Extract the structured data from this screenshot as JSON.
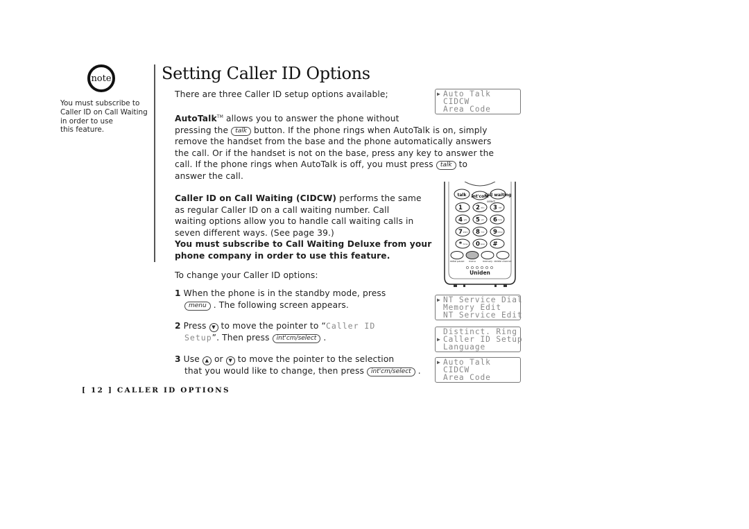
{
  "note": {
    "badge_label": "note",
    "lines": [
      "You must subscribe to",
      "Caller ID on Call Waiting",
      "in order to use",
      "this feature."
    ]
  },
  "title": "Setting Caller ID Options",
  "intro": "There are three Caller ID setup options available;",
  "autotalk": {
    "term": "AutoTalk",
    "tm": "TM",
    "line1_rest": " allows you to answer the phone without",
    "line2_pre": "pressing the ",
    "talk_button": "talk",
    "line2_post": " button. If the phone rings when AutoTalk is on, simply",
    "line3": "remove the handset from the base and the phone automatically answers",
    "line4": "the call. Or if the handset is not on the base, press any key to answer the",
    "line5_pre": "call. If the phone rings when AutoTalk is off, you must press ",
    "line5_post": " to",
    "line6": "answer the call."
  },
  "cidcw": {
    "term": "Caller ID on Call Waiting (CIDCW)",
    "line1_rest": " performs the same",
    "line2": "as regular Caller ID on a call waiting number. Call",
    "line3": "waiting options allow you to handle call waiting calls in",
    "line4": "seven different ways. (See page 39.)",
    "warning_line1": "You must subscribe to Call Waiting Deluxe from your",
    "warning_line2": "phone company in order to use this feature."
  },
  "change_intro": "To change your Caller ID options:",
  "steps": [
    {
      "num": "1",
      "line1": "When the phone is in the standby mode, press",
      "button": "menu",
      "line2_post": ". The following screen appears."
    },
    {
      "num": "2",
      "pre": "Press ",
      "down_icon": "▼",
      "mid": " to move the pointer to “",
      "lcd_text_1": "Caller ID",
      "lcd_text_2": "Setup",
      "post": "”. Then press ",
      "button": "int'cm/select",
      "end": "."
    },
    {
      "num": "3",
      "pre": "Use ",
      "up_icon": "▲",
      "or": " or ",
      "down_icon": "▼",
      "line1_post": " to move the pointer to the selection",
      "line2_pre": "that you would like to change, then press ",
      "button": "int'cm/select",
      "end": "."
    }
  ],
  "lcd_screens": [
    {
      "lines": [
        "Auto Talk",
        "CIDCW",
        "Area Code"
      ],
      "pointer_index": 0
    },
    {
      "lines": [
        "NT Service Dial",
        "Memory Edit",
        "NT Service Edit"
      ],
      "pointer_index": 0
    },
    {
      "lines": [
        "Distinct. Ring",
        "Caller ID Setup",
        "Language"
      ],
      "pointer_index": 1
    },
    {
      "lines": [
        "Auto Talk",
        "CIDCW",
        "Area Code"
      ],
      "pointer_index": 0
    }
  ],
  "phone": {
    "brand": "Uniden",
    "top_keys": [
      "talk",
      "int'com",
      "call waiting"
    ],
    "select_label": "select",
    "digit_keys": [
      {
        "d": "1",
        "l": ""
      },
      {
        "d": "2",
        "l": "abc"
      },
      {
        "d": "3",
        "l": "def"
      },
      {
        "d": "4",
        "l": "ghi"
      },
      {
        "d": "5",
        "l": "jkl"
      },
      {
        "d": "6",
        "l": "mno"
      },
      {
        "d": "7",
        "l": "pqrs"
      },
      {
        "d": "8",
        "l": "tuv"
      },
      {
        "d": "9",
        "l": "wxyz"
      },
      {
        "d": "*",
        "l": "tone"
      },
      {
        "d": "0",
        "l": "oper"
      },
      {
        "d": "#",
        "l": ""
      }
    ],
    "bottom_keys": [
      "redial pause",
      "menu",
      "memory",
      "delete channel"
    ],
    "highlighted_key": "menu",
    "highlight_color": "#b5b5b5"
  },
  "footer": {
    "page": "[ 12 ]",
    "section": "CALLER ID OPTIONS"
  }
}
